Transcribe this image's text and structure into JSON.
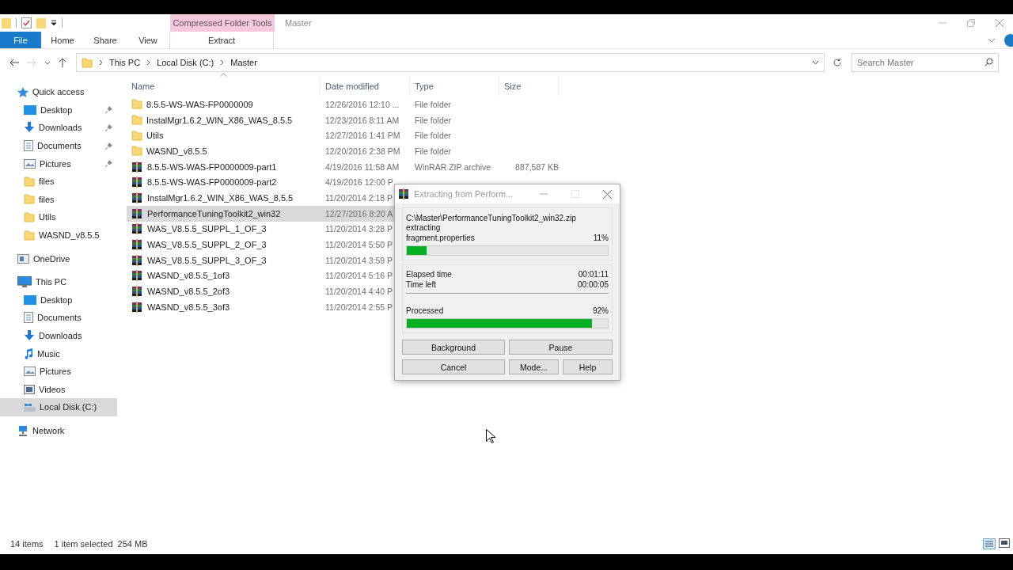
{
  "window": {
    "title": "Master"
  },
  "ribbon": {
    "context_group": "Compressed Folder Tools",
    "tabs": [
      {
        "label": "File",
        "kind": "file"
      },
      {
        "label": "Home",
        "kind": "normal"
      },
      {
        "label": "Share",
        "kind": "normal"
      },
      {
        "label": "View",
        "kind": "normal"
      },
      {
        "label": "Extract",
        "kind": "context"
      }
    ]
  },
  "address_bar": {
    "path": [
      "This PC",
      "Local Disk (C:)",
      "Master"
    ]
  },
  "search": {
    "placeholder": "Search Master"
  },
  "sidebar": {
    "items": [
      {
        "label": "Quick access",
        "kind": "star",
        "selected": false,
        "children": [
          {
            "label": "Desktop",
            "kind": "desktop",
            "pinned": true,
            "selected": false
          },
          {
            "label": "Downloads",
            "kind": "downloads",
            "pinned": true,
            "selected": false
          },
          {
            "label": "Documents",
            "kind": "documents",
            "pinned": true,
            "selected": false
          },
          {
            "label": "Pictures",
            "kind": "pictures",
            "pinned": true,
            "selected": false
          },
          {
            "label": "files",
            "kind": "folder",
            "pinned": false,
            "selected": false
          },
          {
            "label": "files",
            "kind": "folder",
            "pinned": false,
            "selected": false
          },
          {
            "label": "Utils",
            "kind": "folder",
            "pinned": false,
            "selected": false
          },
          {
            "label": "WASND_v8.5.5",
            "kind": "folder",
            "pinned": false,
            "selected": false
          }
        ]
      },
      {
        "label": "OneDrive",
        "kind": "onedrive",
        "selected": false
      },
      {
        "label": "This PC",
        "kind": "pc",
        "selected": false,
        "children": [
          {
            "label": "Desktop",
            "kind": "desktop",
            "selected": false
          },
          {
            "label": "Documents",
            "kind": "documents",
            "selected": false
          },
          {
            "label": "Downloads",
            "kind": "downloads",
            "selected": false
          },
          {
            "label": "Music",
            "kind": "music",
            "selected": false
          },
          {
            "label": "Pictures",
            "kind": "pictures",
            "selected": false
          },
          {
            "label": "Videos",
            "kind": "videos",
            "selected": false
          },
          {
            "label": "Local Disk (C:)",
            "kind": "drive",
            "selected": true
          }
        ]
      },
      {
        "label": "Network",
        "kind": "network",
        "selected": false
      }
    ]
  },
  "file_list": {
    "columns": [
      "Name",
      "Date modified",
      "Type",
      "Size"
    ],
    "rows": [
      {
        "name": "8.5.5-WS-WAS-FP0000009",
        "date": "12/26/2016 12:10 ...",
        "type": "File folder",
        "kind": "folder",
        "selected": false
      },
      {
        "name": "InstalMgr1.6.2_WIN_X86_WAS_8.5.5",
        "date": "12/23/2016 8:11 AM",
        "type": "File folder",
        "kind": "folder",
        "selected": false
      },
      {
        "name": "Utils",
        "date": "12/27/2016 1:41 PM",
        "type": "File folder",
        "kind": "folder",
        "selected": false
      },
      {
        "name": "WASND_v8.5.5",
        "date": "12/20/2016 2:38 PM",
        "type": "File folder",
        "kind": "folder",
        "selected": false
      },
      {
        "name": "8.5.5-WS-WAS-FP0000009-part1",
        "date": "4/19/2016 11:58 AM",
        "type": "WinRAR ZIP archive",
        "size": "887,587 KB",
        "kind": "archive",
        "selected": false
      },
      {
        "name": "8.5.5-WS-WAS-FP0000009-part2",
        "date": "4/19/2016 12:00 P",
        "kind": "archive",
        "selected": false
      },
      {
        "name": "InstalMgr1.6.2_WIN_X86_WAS_8.5.5",
        "date": "11/20/2014 2:18 P",
        "kind": "archive",
        "selected": false
      },
      {
        "name": "PerformanceTuningToolkit2_win32",
        "date": "12/27/2016 8:20 A",
        "kind": "archive",
        "selected": true
      },
      {
        "name": "WAS_V8.5.5_SUPPL_1_OF_3",
        "date": "11/20/2014 3:28 P",
        "kind": "archive",
        "selected": false
      },
      {
        "name": "WAS_V8.5.5_SUPPL_2_OF_3",
        "date": "11/20/2014 5:50 P",
        "kind": "archive",
        "selected": false
      },
      {
        "name": "WAS_V8.5.5_SUPPL_3_OF_3",
        "date": "11/20/2014 3:59 P",
        "kind": "archive",
        "selected": false
      },
      {
        "name": "WASND_v8.5.5_1of3",
        "date": "11/20/2014 5:16 P",
        "kind": "archive",
        "selected": false
      },
      {
        "name": "WASND_v8.5.5_2of3",
        "date": "11/20/2014 4:40 P",
        "kind": "archive",
        "selected": false
      },
      {
        "name": "WASND_v8.5.5_3of3",
        "date": "11/20/2014 2:55 P",
        "kind": "archive",
        "selected": false
      }
    ]
  },
  "status_bar": {
    "item_count": "14 items",
    "selection": "1 item selected",
    "selection_size": "254 MB"
  },
  "dialog": {
    "title": "Extracting from Perform...",
    "archive_path": "C:\\Master\\PerformanceTuningToolkit2_win32.zip",
    "action": "extracting",
    "file": "fragment.properties",
    "file_percent": "11%",
    "file_progress": {
      "level": 0.1
    },
    "elapsed_label": "Elapsed time",
    "elapsed": "00:01:11",
    "left_label": "Time left",
    "left": "00:00:05",
    "processed_label": "Processed",
    "processed_percent": "92%",
    "processed_progress": {
      "level": 0.92
    },
    "button_rows": [
      [
        "Background",
        "Pause"
      ],
      [
        "Cancel",
        "Mode...",
        "Help"
      ]
    ]
  }
}
